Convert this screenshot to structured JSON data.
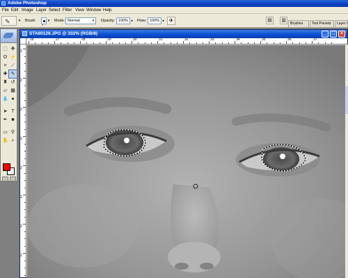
{
  "app": {
    "title": "Adobe Photoshop"
  },
  "menu": [
    "File",
    "Edit",
    "Image",
    "Layer",
    "Select",
    "Filter",
    "View",
    "Window",
    "Help"
  ],
  "options_bar": {
    "brush_label": "Brush:",
    "brush_size": "1",
    "mode_label": "Mode:",
    "mode_value": "Normal",
    "opacity_label": "Opacity:",
    "opacity_value": "100%",
    "flow_label": "Flow:",
    "flow_value": "100%"
  },
  "palette_well": {
    "tabs": [
      "Brushes",
      "Tool Presets",
      "Layer C"
    ]
  },
  "toolbox": {
    "foreground_color": "#ff0000",
    "background_color": "#ffffff",
    "tools": [
      "marquee-icon",
      "move-icon",
      "lasso-icon",
      "magic-wand-icon",
      "crop-icon",
      "slice-icon",
      "healing-icon",
      "brush-icon",
      "stamp-icon",
      "history-brush-icon",
      "eraser-icon",
      "gradient-icon",
      "blur-icon",
      "dodge-icon",
      "path-select-icon",
      "type-icon",
      "pen-icon",
      "shape-icon",
      "notes-icon",
      "eyedropper-icon",
      "hand-icon",
      "zoom-icon"
    ]
  },
  "document": {
    "title": "STA60126.JPG @ 332% (RGB/8)",
    "ruler_top_numbers": [
      "26",
      "27",
      "28",
      "29",
      "30",
      "31",
      "32",
      "33",
      "34",
      "35",
      "36",
      "37"
    ],
    "ruler_left_numbers": [
      "1",
      "2",
      "2",
      "2",
      "2",
      "2",
      "2",
      "2"
    ]
  }
}
